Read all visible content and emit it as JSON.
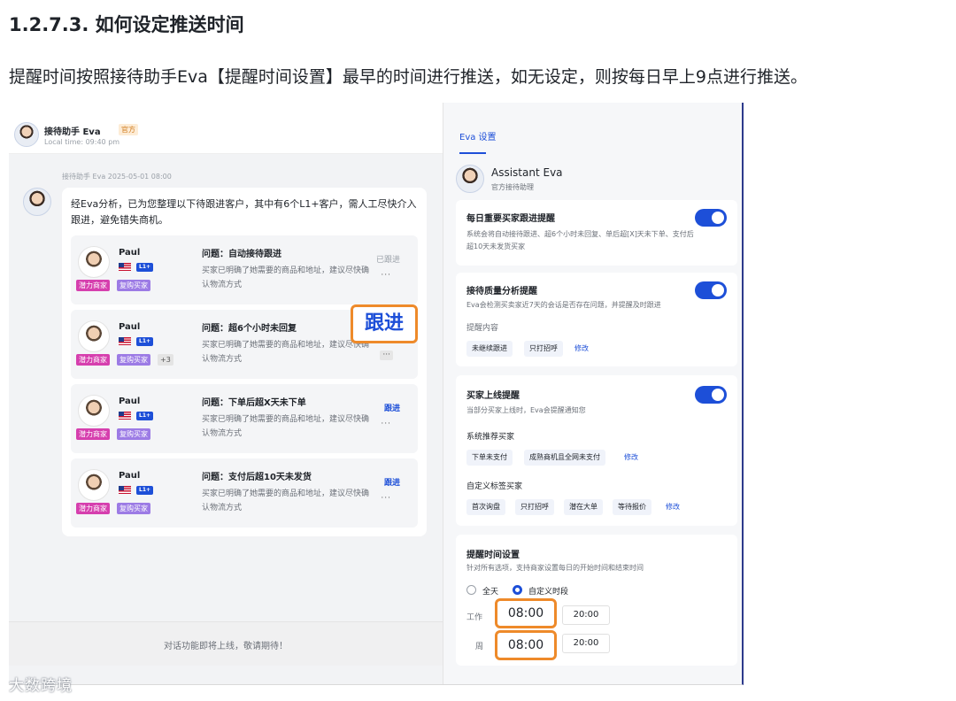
{
  "doc": {
    "heading": "1.2.7.3. 如何设定推送时间",
    "paragraph": "提醒时间按照接待助手Eva【提醒时间设置】最早的时间进行推送，如无设定，则按每日早上9点进行推送。"
  },
  "chat": {
    "header_name": "接待助手 Eva",
    "header_badge": "官方",
    "header_time": "Local time: 09:40 pm",
    "msg_meta": "接待助手 Eva  2025-05-01 08:00",
    "msg_text": "经Eva分析，已为您整理以下待跟进客户，其中有6个L1+客户，需人工尽快介入跟进，避免错失商机。",
    "cards": [
      {
        "name": "Paul",
        "level": "L1+",
        "tag1": "潜力商家",
        "tag2": "复购买家",
        "tag3": "",
        "question": "问题：自动接待跟进",
        "desc": "买家已明确了她需要的商品和地址，建议尽快确认物流方式",
        "action": "已跟进",
        "more": "···"
      },
      {
        "name": "Paul",
        "level": "L1+",
        "tag1": "潜力商家",
        "tag2": "复购买家",
        "tag3": "+3",
        "question": "问题：超6个小时未回复",
        "desc": "买家已明确了她需要的商品和地址，建议尽快确认物流方式",
        "action": "",
        "more": "···"
      },
      {
        "name": "Paul",
        "level": "L1+",
        "tag1": "潜力商家",
        "tag2": "复购买家",
        "tag3": "",
        "question": "问题：下单后超X天未下单",
        "desc": "买家已明确了她需要的商品和地址，建议尽快确认物流方式",
        "action": "跟进",
        "more": "···"
      },
      {
        "name": "Paul",
        "level": "L1+",
        "tag1": "潜力商家",
        "tag2": "复购买家",
        "tag3": "",
        "question": "问题：支付后超10天未发货",
        "desc": "买家已明确了她需要的商品和地址，建议尽快确认物流方式",
        "action": "跟进",
        "more": "···"
      }
    ],
    "highlight_follow": "跟进",
    "footer": "对话功能即将上线，敬请期待！"
  },
  "settings": {
    "tab": "Eva 设置",
    "name": "Assistant Eva",
    "sub": "官方接待助理",
    "sec1": {
      "title": "每日重要买家跟进提醒",
      "desc": "系统会将自动接待跟进、超6个小时未回复、单后超[X]天未下单、支付后超10天未发货买家",
      "toggle": "on"
    },
    "sec2": {
      "title": "接待质量分析提醒",
      "desc": "Eva会检测买卖家近7天的会话是否存在问题，并提醒及时跟进",
      "content_label": "提醒内容",
      "chips": [
        "未继续跟进",
        "只打招呼"
      ],
      "edit": "修改",
      "toggle": "on"
    },
    "sec3": {
      "title": "买家上线提醒",
      "desc": "当部分买家上线时，Eva会提醒通知您",
      "rec_label": "系统推荐买家",
      "rec_chips": [
        "下单未支付",
        "成熟商机且全网未支付"
      ],
      "rec_edit": "修改",
      "custom_label": "自定义标签买家",
      "custom_chips": [
        "首次询盘",
        "只打招呼",
        "潜在大单",
        "等待报价"
      ],
      "custom_edit": "修改",
      "toggle": "on"
    },
    "sec4": {
      "title": "提醒时间设置",
      "desc": "针对所有选项，支持商家设置每日的开始时间和结束时间",
      "opt_allday": "全天",
      "opt_custom": "自定义时段",
      "row1_label": "工作",
      "row2_label": "周",
      "row1_start": "08:00",
      "row1_end": "20:00",
      "row2_start": "08:00",
      "row2_end": "20:00"
    }
  },
  "watermark": "大数跨境",
  "colors": {
    "accent": "#1d4fd8",
    "highlight": "#ee8a2a",
    "tag_pink": "#d63fae",
    "tag_purple": "#9c7be5"
  }
}
